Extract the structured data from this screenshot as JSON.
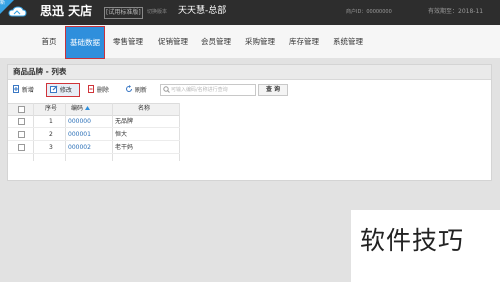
{
  "colors": {
    "topbar_bg": "#2d2d2d",
    "accent": "#2f8fdc",
    "highlight_border": "#d0343a",
    "link": "#2a6fb7"
  },
  "header": {
    "corner_ribbon": "新",
    "logo": "思迅 天店",
    "edition": "[试用标准版]",
    "switch_version": "切换版本",
    "store_name": "天天慧-总部",
    "user_id_label": "商户ID：",
    "user_id_value": "00000000",
    "expire_label": "有效期至：",
    "expire_value": "2018-11"
  },
  "nav": {
    "items": [
      "首页",
      "基础数据",
      "零售管理",
      "促销管理",
      "会员管理",
      "采购管理",
      "库存管理",
      "系统管理"
    ],
    "active": "基础数据"
  },
  "panel": {
    "title": "商品品牌 - 列表"
  },
  "toolbar": {
    "add": "新增",
    "edit": "修改",
    "delete": "删除",
    "refresh": "刷新",
    "search_placeholder": "可输入编码/名称进行查询",
    "search_button": "查 询"
  },
  "icons": {
    "add": "add-doc-icon",
    "edit": "edit-icon",
    "delete": "delete-doc-icon",
    "refresh": "refresh-icon",
    "search": "search-icon",
    "sort": "sort-asc-icon"
  },
  "grid": {
    "columns": [
      "序号",
      "编码",
      "名称"
    ],
    "rows": [
      {
        "index": "1",
        "code": "000000",
        "name": "无品牌"
      },
      {
        "index": "2",
        "code": "000001",
        "name": "恒大"
      },
      {
        "index": "3",
        "code": "000002",
        "name": "老干妈"
      }
    ]
  },
  "watermark": "软件技巧"
}
